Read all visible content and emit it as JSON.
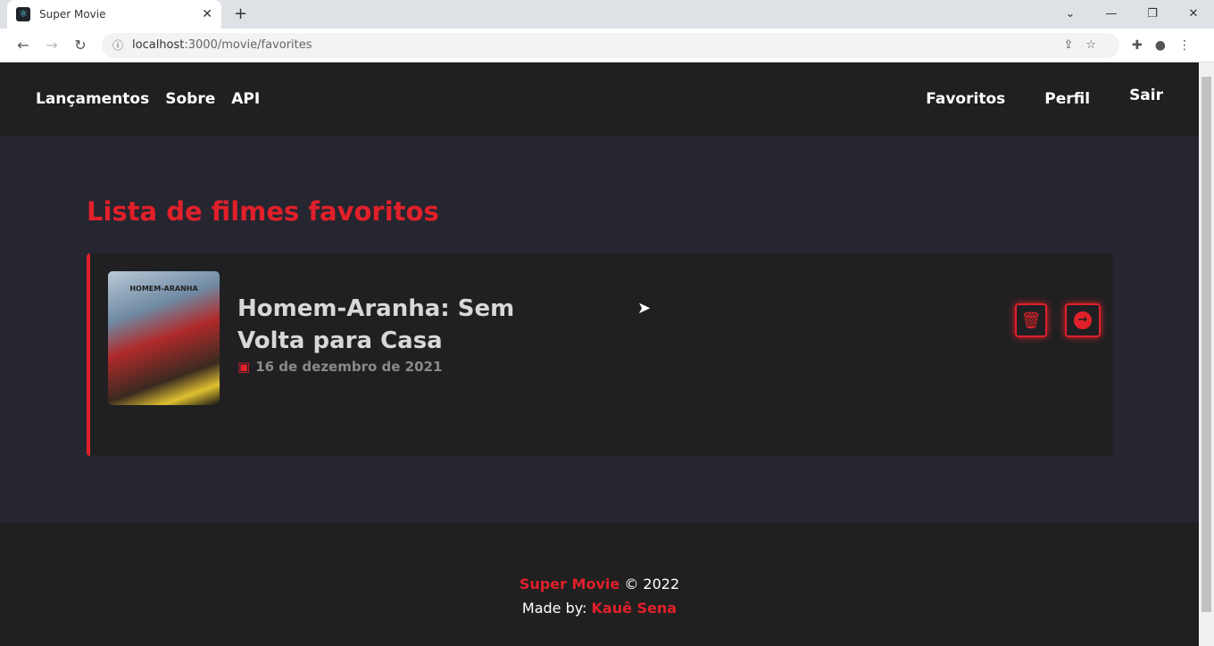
{
  "browser": {
    "tab_title": "Super Movie",
    "url_host": "localhost",
    "url_path": ":3000/movie/favorites"
  },
  "nav": {
    "left": [
      "Lançamentos",
      "Sobre",
      "API"
    ],
    "right": [
      "Favoritos",
      "Perfil",
      "Sair"
    ]
  },
  "page_title": "Lista de filmes favoritos",
  "favorites": [
    {
      "title": "Homem-Aranha: Sem Volta para Casa",
      "date": "16 de dezembro de 2021",
      "poster_text": "HOMEM-ARANHA"
    }
  ],
  "footer": {
    "brand": "Super Movie",
    "copyright": "© 2022",
    "made_by_label": "Made by:",
    "author": "Kauê Sena"
  },
  "colors": {
    "accent": "#e0202a",
    "background": "#262630",
    "header": "#202020"
  }
}
